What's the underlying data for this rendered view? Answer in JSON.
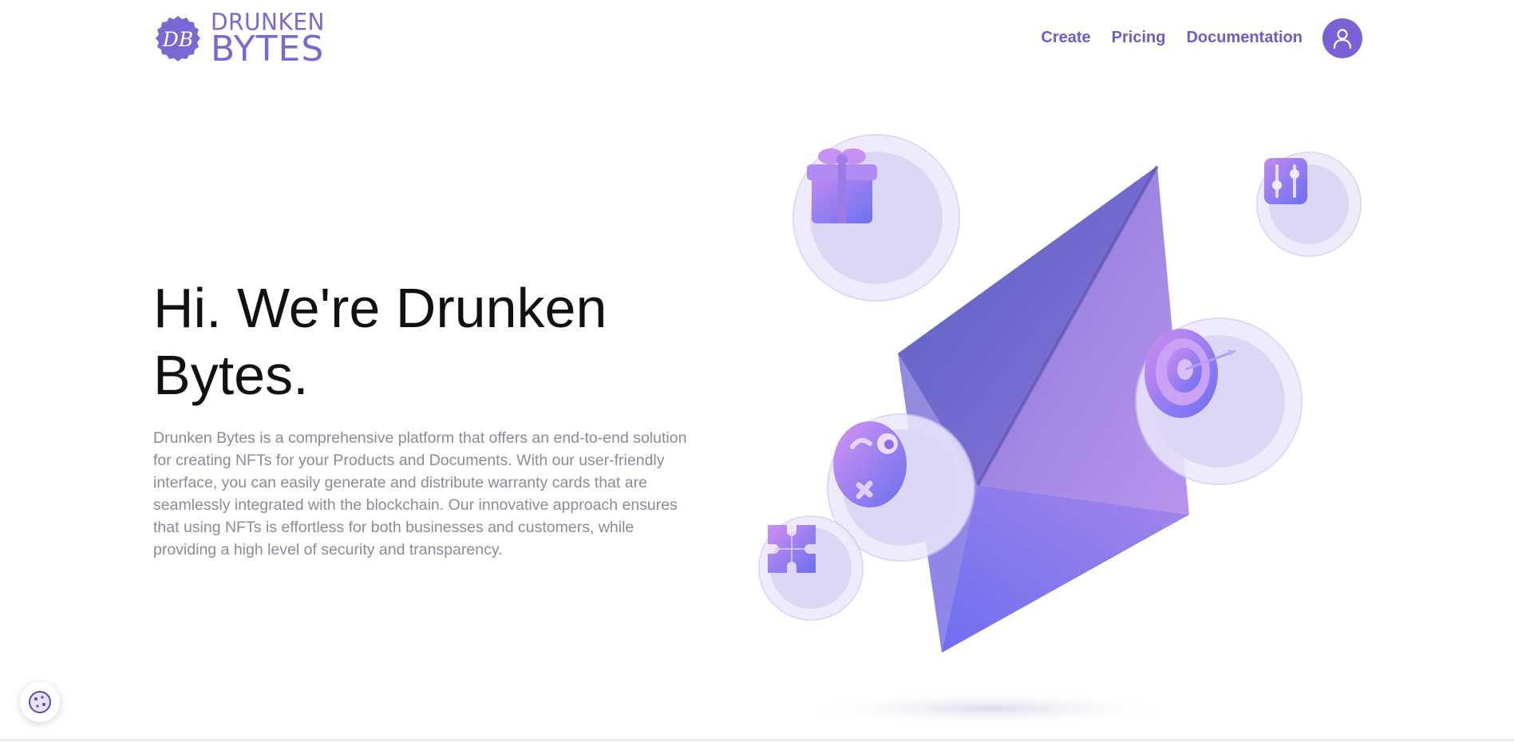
{
  "brand": {
    "monogram": "DB",
    "name_line1": "DRUNKEN",
    "name_line2": "BYTES",
    "color": "#7c68d4"
  },
  "nav": {
    "items": [
      {
        "label": "Create"
      },
      {
        "label": "Pricing"
      },
      {
        "label": "Documentation"
      }
    ],
    "account_icon": "user-icon"
  },
  "hero": {
    "title": "Hi. We're Drunken Bytes.",
    "description": "Drunken Bytes is a comprehensive platform that offers an end-to-end solution for creating NFTs for your Products and Documents. With our user-friendly interface, you can easily generate and distribute warranty cards that are seamlessly integrated with the blockchain. Our innovative approach ensures that using NFTs is effortless for both businesses and customers, while providing a high level of security and transparency."
  },
  "illustration": {
    "main_icon": "ethereum-icon",
    "bubbles": [
      "gift-icon",
      "sliders-icon",
      "target-icon",
      "face-icon",
      "puzzle-icon"
    ]
  },
  "cookie": {
    "icon": "cookie-icon"
  },
  "colors": {
    "accent": "#7a62d6",
    "nav": "#6e5cc9",
    "text": "#111111",
    "muted": "#8b8a98"
  }
}
